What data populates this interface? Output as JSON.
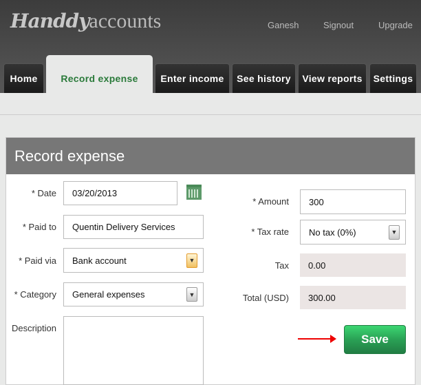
{
  "app": {
    "logo_script": "Handdy",
    "logo_rest": "accounts"
  },
  "top_links": [
    "Ganesh",
    "Signout",
    "Upgrade"
  ],
  "tabs": [
    "Home",
    "Record expense",
    "Enter income",
    "See history",
    "View reports",
    "Settings"
  ],
  "active_tab": "Record expense",
  "panel": {
    "title": "Record expense"
  },
  "form": {
    "date": {
      "label": "* Date",
      "value": "03/20/2013"
    },
    "paid_to": {
      "label": "* Paid to",
      "value": "Quentin Delivery Services"
    },
    "paid_via": {
      "label": "* Paid via",
      "value": "Bank account"
    },
    "category": {
      "label": "* Category",
      "value": "General expenses"
    },
    "description": {
      "label": "Description",
      "value": ""
    },
    "amount": {
      "label": "* Amount",
      "value": "300"
    },
    "tax_rate": {
      "label": "* Tax rate",
      "value": "No tax (0%)"
    },
    "tax": {
      "label": "Tax",
      "value": "0.00"
    },
    "total": {
      "label": "Total (USD)",
      "value": "300.00"
    },
    "save_label": "Save"
  },
  "colors": {
    "accent": "#2a7a3a",
    "save": "#2aa155",
    "arrow": "#e00000"
  },
  "icons": {
    "calendar": "calendar-icon",
    "dropdown": "chevron-down-icon"
  }
}
